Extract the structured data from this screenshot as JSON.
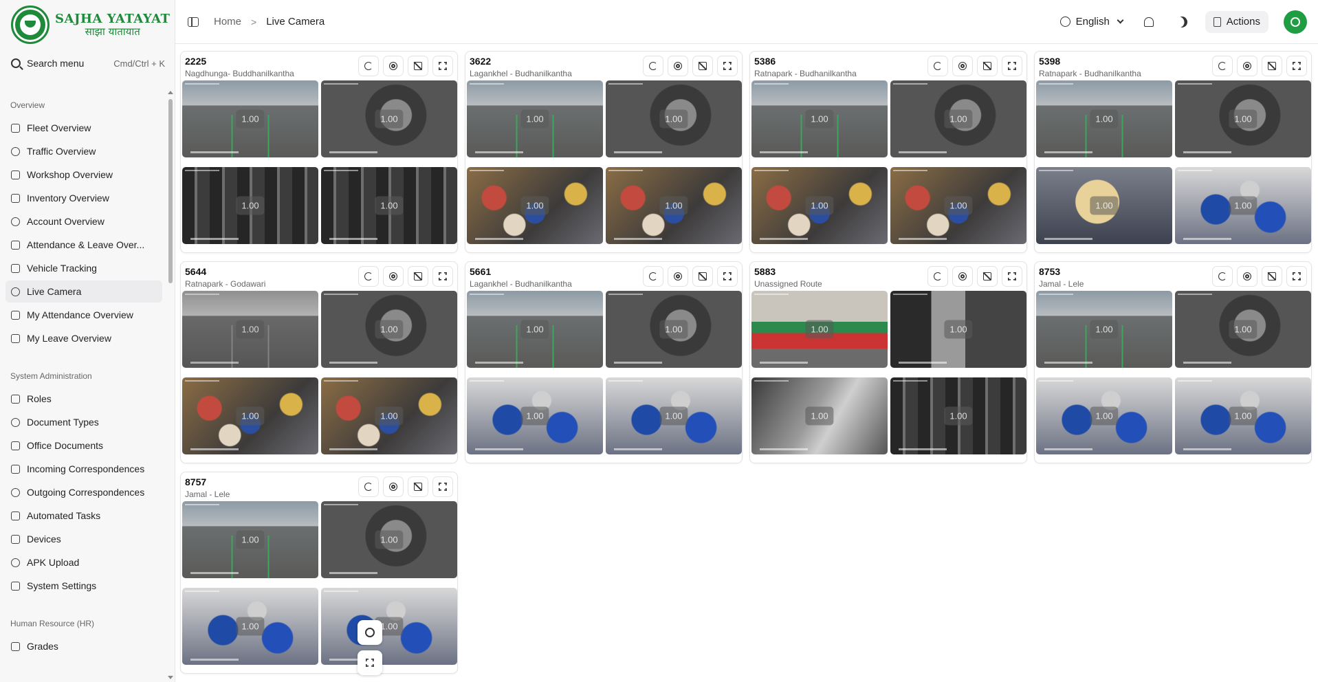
{
  "brand": {
    "name_en": "SAJHA YATAYAT",
    "name_np": "साझा यातायात"
  },
  "search": {
    "label": "Search menu",
    "shortcut": "Cmd/Ctrl + K"
  },
  "sidebar": {
    "sections": [
      {
        "title": "Overview",
        "items": [
          {
            "label": "Fleet Overview",
            "icon": "bus-icon"
          },
          {
            "label": "Traffic Overview",
            "icon": "route-icon"
          },
          {
            "label": "Workshop Overview",
            "icon": "clipboard-icon"
          },
          {
            "label": "Inventory Overview",
            "icon": "building-icon"
          },
          {
            "label": "Account Overview",
            "icon": "bank-icon"
          },
          {
            "label": "Attendance & Leave Over...",
            "icon": "user-clock-icon"
          },
          {
            "label": "Vehicle Tracking",
            "icon": "map-icon"
          },
          {
            "label": "Live Camera",
            "icon": "camera-icon",
            "active": true
          },
          {
            "label": "My Attendance Overview",
            "icon": "fingerprint-icon"
          },
          {
            "label": "My Leave Overview",
            "icon": "user-leave-icon"
          }
        ]
      },
      {
        "title": "System Administration",
        "items": [
          {
            "label": "Roles",
            "icon": "user-key-icon"
          },
          {
            "label": "Document Types",
            "icon": "document-icon"
          },
          {
            "label": "Office Documents",
            "icon": "document-icon"
          },
          {
            "label": "Incoming Correspondences",
            "icon": "document-icon"
          },
          {
            "label": "Outgoing Correspondences",
            "icon": "document-icon"
          },
          {
            "label": "Automated Tasks",
            "icon": "gear-target-icon"
          },
          {
            "label": "Devices",
            "icon": "devices-icon"
          },
          {
            "label": "APK Upload",
            "icon": "android-icon"
          },
          {
            "label": "System Settings",
            "icon": "gear-icon"
          }
        ]
      },
      {
        "title": "Human Resource (HR)",
        "items": [
          {
            "label": "Grades",
            "icon": "trophy-icon"
          }
        ]
      }
    ]
  },
  "header": {
    "breadcrumb": [
      "Home",
      "Live Camera"
    ],
    "language": "English",
    "actions_label": "Actions"
  },
  "feed_overlay": "1.00",
  "cards": [
    {
      "bus": "2225",
      "route": "Nagdhunga- Buddhanilkantha",
      "feeds": [
        "road",
        "cabin",
        "seats",
        "seats"
      ]
    },
    {
      "bus": "3622",
      "route": "Lagankhel - Budhanilkantha",
      "feeds": [
        "road",
        "cabin",
        "crowd",
        "crowd"
      ]
    },
    {
      "bus": "5386",
      "route": "Ratnapark - Budhanilkantha",
      "feeds": [
        "road",
        "cabin",
        "crowd",
        "crowd"
      ]
    },
    {
      "bus": "5398",
      "route": "Ratnapark - Budhanilkantha",
      "feeds": [
        "road",
        "cabin",
        "ticket",
        "bluebus"
      ]
    },
    {
      "bus": "5644",
      "route": "Ratnapark - Godawari",
      "feeds": [
        "road-bw",
        "cabin",
        "crowd",
        "crowd"
      ]
    },
    {
      "bus": "5661",
      "route": "Lagankhel - Budhanilkantha",
      "feeds": [
        "road",
        "cabin",
        "bluebus",
        "bluebus"
      ]
    },
    {
      "bus": "5883",
      "route": "Unassigned Route",
      "feeds": [
        "busfront",
        "doorbw",
        "blurgray",
        "seats"
      ]
    },
    {
      "bus": "8753",
      "route": "Jamal - Lele",
      "feeds": [
        "road",
        "cabin",
        "bluebus",
        "bluebus"
      ]
    },
    {
      "bus": "8757",
      "route": "Jamal - Lele",
      "feeds": [
        "road",
        "cabin",
        "bluebus",
        "bluebus"
      ]
    }
  ],
  "colors": {
    "brand_green": "#1e8a3a",
    "avatar_green": "#1f9d43",
    "active_bg": "#ececee"
  }
}
